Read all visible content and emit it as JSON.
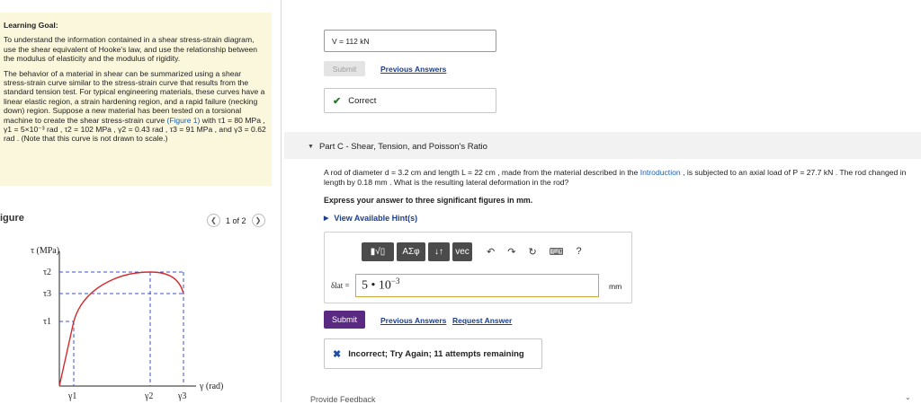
{
  "learning_goal": {
    "title": "Learning Goal:",
    "para1": "To understand the information contained in a shear stress-strain diagram, use the shear equivalent of Hooke's law, and use the relationship between the modulus of elasticity and the modulus of rigidity.",
    "para2_a": "The behavior of a material in shear can be summarized using a shear stress-strain curve similar to the stress-strain curve that results from the standard tension test. For typical engineering materials, these curves have a linear elastic region, a strain hardening region, and a rapid failure (necking down) region. Suppose a new material has been tested on a torsional machine to create the shear stress-strain curve",
    "figure_link": "(Figure 1)",
    "para2_b": "with τ1 = 80 MPa , γ1 = 5×10⁻³ rad , τ2 = 102 MPa , γ2 = 0.43 rad , τ3 = 91 MPa , and γ3 = 0.62 rad . (Note that this curve is not drawn to scale.)"
  },
  "figure": {
    "label": "igure",
    "pager": "1 of 2",
    "prev_icon": "chevron-left-icon",
    "next_icon": "chevron-right-icon",
    "y_axis_label": "τ (MPa)",
    "x_axis_label": "γ (rad)",
    "y_ticks": [
      "τ2",
      "τ3",
      "τ1"
    ],
    "x_ticks": [
      "γ1",
      "γ2",
      "γ3"
    ]
  },
  "previous_part": {
    "answer_text": "V =  112  kN",
    "submit_label": "Submit",
    "previous_answers": "Previous Answers",
    "feedback": "Correct"
  },
  "part_c": {
    "header": "Part C - Shear, Tension, and Poisson's Ratio",
    "problem_a": "A rod of diameter d = 3.2 cm and length L = 22 cm , made from the material described in the",
    "problem_link": "Introduction",
    "problem_b": ", is subjected to an axial load of P = 27.7 kN . The rod changed in length by 0.18 mm . What is the resulting lateral deformation in the rod?",
    "instruction": "Express your answer to three significant figures in mm.",
    "hints": "View Available Hint(s)",
    "toolbar": {
      "template": "▮√▯",
      "greek": "ΑΣφ",
      "arrows": "↓↑",
      "vec": "vec"
    },
    "tools": [
      "undo-icon",
      "redo-icon",
      "reset-icon",
      "keyboard-icon",
      "help-icon"
    ],
    "help_label": "?",
    "variable_label": "δlat =",
    "input_value": "5 • 10",
    "input_exponent": "−3",
    "unit": "mm",
    "submit_label": "Submit",
    "previous_answers": "Previous Answers",
    "request_answer": "Request Answer",
    "feedback": "Incorrect; Try Again; 11 attempts remaining"
  },
  "footer": {
    "cut_text": "Provide Feedback"
  },
  "colors": {
    "curve": "#d32b2b",
    "dashed": "#3b50c8",
    "submit": "#5a2a82",
    "goal_bg": "#fbf7dc"
  }
}
